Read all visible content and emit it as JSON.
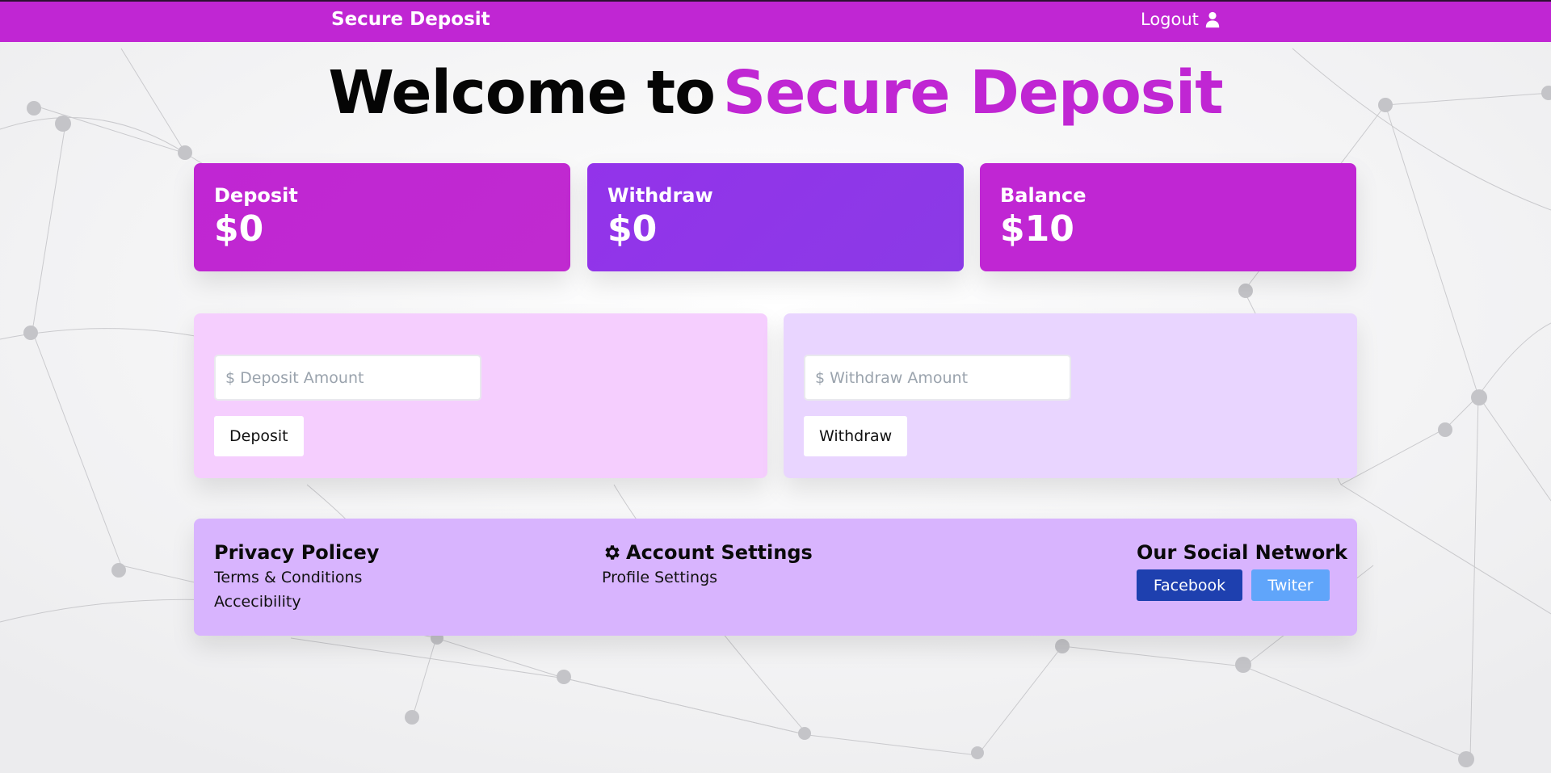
{
  "navbar": {
    "brand": "Secure Deposit",
    "logout_label": "Logout",
    "logout_icon": "user-icon",
    "bg_color": "#c026d3"
  },
  "hero": {
    "part1": "Welcome to",
    "part2": "Secure Deposit"
  },
  "stats": [
    {
      "label": "Deposit",
      "value": "$0",
      "color": "#c026d3"
    },
    {
      "label": "Withdraw",
      "value": "$0",
      "color": "#9333ea"
    },
    {
      "label": "Balance",
      "value": "$10",
      "color": "#c026d3"
    }
  ],
  "deposit_form": {
    "placeholder": "$ Deposit Amount",
    "value": "",
    "button_label": "Deposit"
  },
  "withdraw_form": {
    "placeholder": "$ Withdraw Amount",
    "value": "",
    "button_label": "Withdraw"
  },
  "footer": {
    "col1": {
      "title": "Privacy Policey",
      "links": [
        "Terms & Conditions",
        "Accecibility"
      ]
    },
    "col2": {
      "icon": "gear-icon",
      "title": "Account Settings",
      "links": [
        "Profile Settings"
      ]
    },
    "col3": {
      "title": "Our Social Network",
      "facebook_label": "Facebook",
      "twitter_label": "Twiter",
      "facebook_color": "#1e40af",
      "twitter_color": "#60a5fa"
    }
  }
}
